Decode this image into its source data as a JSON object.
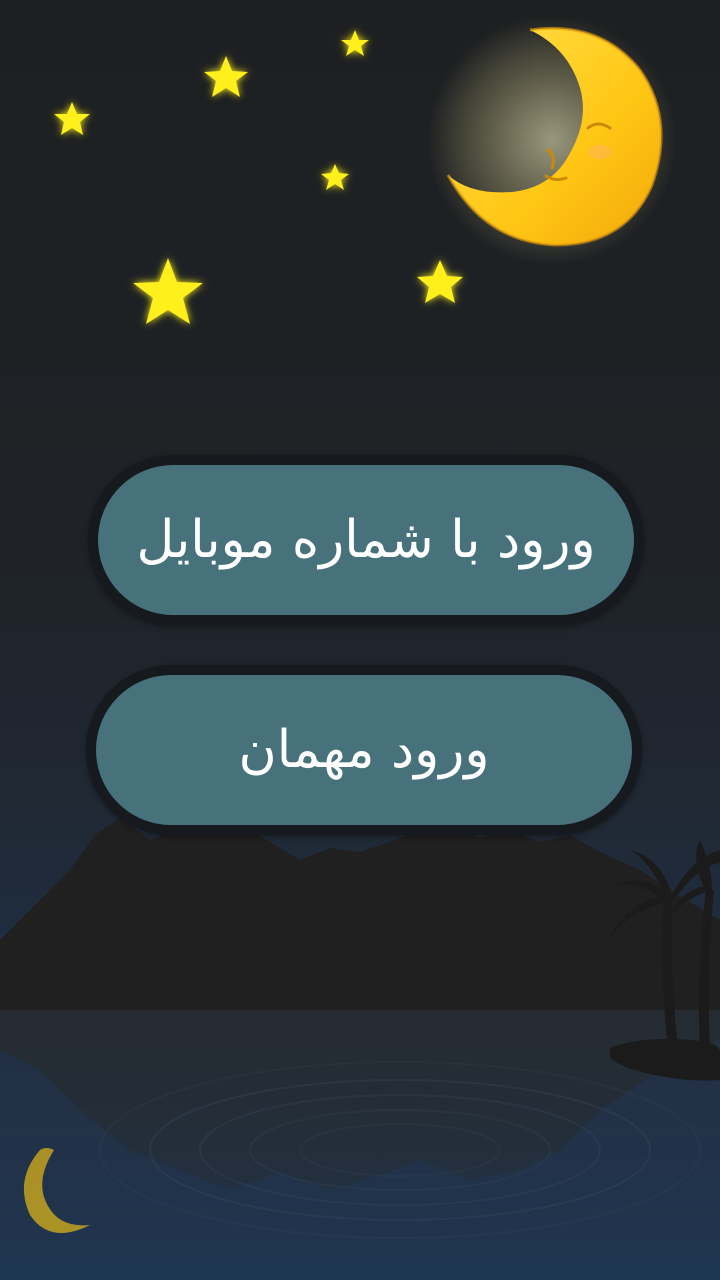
{
  "login": {
    "mobile_label": "ورود با شماره موبایل",
    "guest_label": "ورود مهمان"
  },
  "colors": {
    "button_fill": "#47727b",
    "button_border": "#16191d",
    "star": "#fff01f",
    "moon": "#ffd21a"
  },
  "icons": {
    "moon": "sleeping-moon-icon",
    "star": "star-icon",
    "palm": "palm-tree-icon"
  }
}
